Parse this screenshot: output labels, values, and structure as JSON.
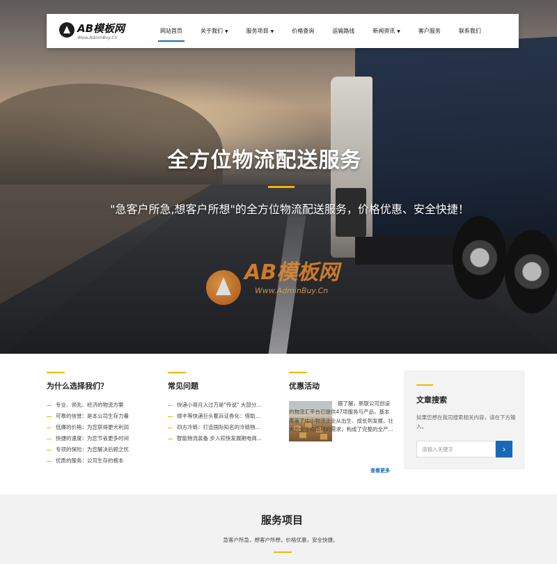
{
  "logo": {
    "name": "AB模板网",
    "url": "Www.AdminBuy.Cn"
  },
  "nav": {
    "items": [
      {
        "label": "网站首页",
        "active": true,
        "dropdown": false
      },
      {
        "label": "关于我们",
        "active": false,
        "dropdown": true
      },
      {
        "label": "服务项目",
        "active": false,
        "dropdown": true
      },
      {
        "label": "价格查询",
        "active": false,
        "dropdown": false
      },
      {
        "label": "运输路线",
        "active": false,
        "dropdown": false
      },
      {
        "label": "新闻资讯",
        "active": false,
        "dropdown": true
      },
      {
        "label": "客户服务",
        "active": false,
        "dropdown": false
      },
      {
        "label": "联系我们",
        "active": false,
        "dropdown": false
      }
    ]
  },
  "hero": {
    "title": "全方位物流配送服务",
    "subtitle": "\"急客户所急,想客户所想\"的全方位物流配送服务，价格优惠、安全快捷！"
  },
  "watermark": {
    "name": "AB模板网",
    "url": "Www.AdminBuy.Cn"
  },
  "why": {
    "title": "为什么选择我们？",
    "items": [
      "专业、领先、经济的物流方案",
      "可靠的信誉：是本公司生存力量",
      "低廉的价格：为您获得更大利润",
      "快捷的速度：为您节省更多时间",
      "专项的保险：为您解决后顾之忧",
      "优质的服务：公司生存的根本"
    ]
  },
  "faq": {
    "title": "常见问题",
    "items": [
      "快递小哥月入过万是\"传说\" 大部分...",
      "顺丰等快递巨头瞿兵证券化：借助...",
      "四方冷链：打造国际知名的冷链物...",
      "智能物流装备 步入较快发展期电商..."
    ]
  },
  "promo": {
    "title": "优惠活动",
    "text": "据了解，新联公司创设的物流汇平台已提供47项服务与产品，基本覆盖了中小物流企业从出生、成长到发展、壮大的全生命周期的需求，构成了完整的全产...",
    "more": "查看更多"
  },
  "search": {
    "title": "文章搜索",
    "desc": "如果您想在我司搜索相关内容，请在下方输入。",
    "placeholder": "请输入关键字",
    "button_icon": "chevron-right-icon"
  },
  "services": {
    "title": "服务项目",
    "subtitle": "急客户所急，想客户所想，价格优惠，安全快捷。"
  },
  "colors": {
    "accent": "#1769b8",
    "highlight": "#f4b400"
  }
}
